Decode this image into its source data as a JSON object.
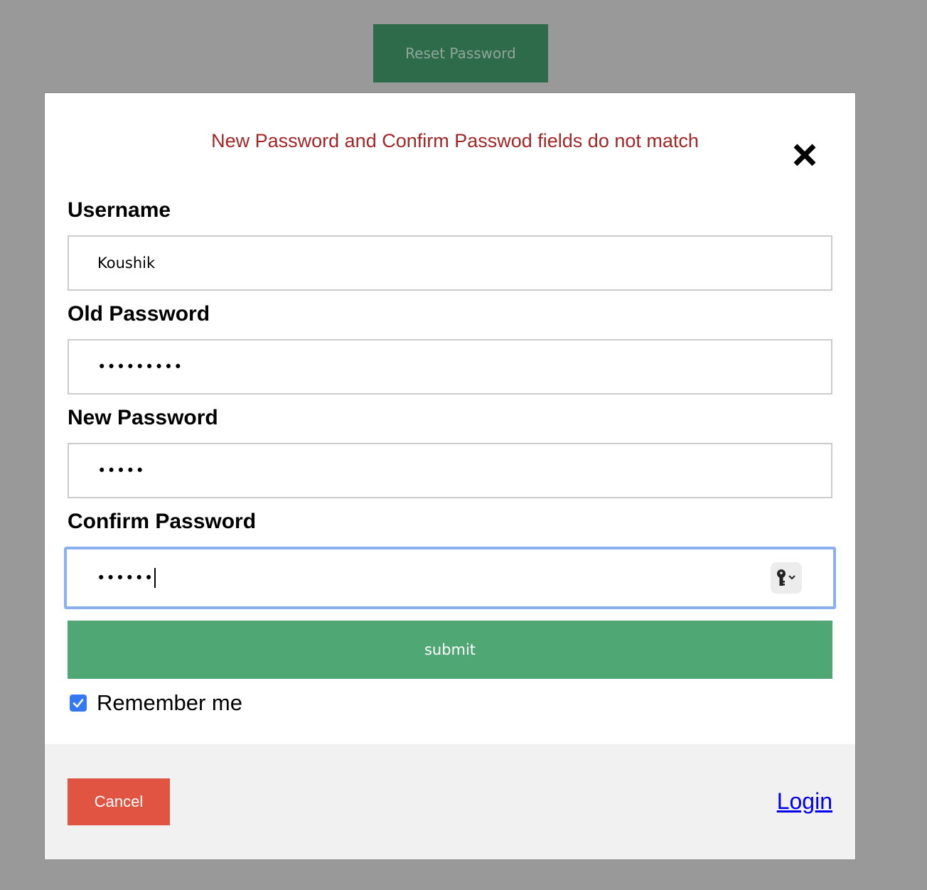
{
  "page": {
    "reset_button_label": "Reset Password"
  },
  "modal": {
    "error_message": "New Password and Confirm Passwod fields do not match",
    "close_icon": "close-x-icon",
    "fields": {
      "username": {
        "label": "Username",
        "value": "Koushik"
      },
      "old_password": {
        "label": "Old Password",
        "value": "•••••••••"
      },
      "new_password": {
        "label": "New Password",
        "value": "•••••"
      },
      "confirm_password": {
        "label": "Confirm Password",
        "value": "••••••",
        "autofill_icon": "key-icon"
      }
    },
    "submit_label": "submit",
    "remember_me": {
      "label": "Remember me",
      "checked": true
    },
    "footer": {
      "cancel_label": "Cancel",
      "login_label": "Login"
    }
  },
  "colors": {
    "overlay_background": "#999999",
    "reset_button_bg": "#2e6b4a",
    "error_text": "#a32626",
    "submit_bg": "#4fa773",
    "cancel_bg": "#e05441",
    "focus_ring": "#8ab0ef",
    "checkbox_bg": "#3478f6",
    "link": "#0000ee"
  }
}
